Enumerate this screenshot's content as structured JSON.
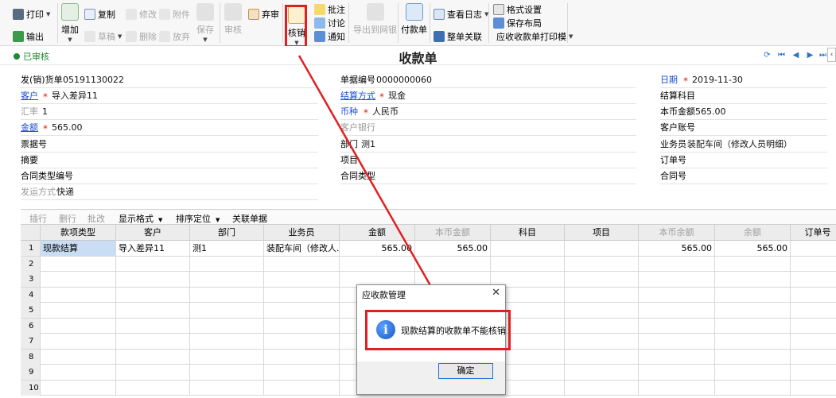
{
  "toolbar": {
    "print": "打印",
    "export": "输出",
    "add": "增加",
    "copy": "复制",
    "draft": "草稿",
    "modify": "修改",
    "delete": "删除",
    "attachment": "附件",
    "abandon": "放弃",
    "save": "保存",
    "audit": "审核",
    "unaudit": "弃审",
    "writeoff": "核销",
    "annotate": "批注",
    "discuss": "讨论",
    "notify": "通知",
    "export_netbank": "导出到网银",
    "payment_order": "付款单",
    "view_log": "查看日志",
    "full_relation": "整单关联",
    "format_settings": "格式设置",
    "save_layout": "保存布局",
    "print_template": "应收收款单打印模"
  },
  "header": {
    "status": "已审核",
    "title": "收款单"
  },
  "form": {
    "invoice_no_label": "发(销)货单",
    "invoice_no": "05191130022",
    "doc_no_label": "单据编号",
    "doc_no": "0000000060",
    "date_label": "日期",
    "date": "2019-11-30",
    "customer_label": "客户",
    "customer": "导入差异11",
    "settle_method_label": "结算方式",
    "settle_method": "现金",
    "settle_subject_label": "结算科目",
    "rate_label": "汇率",
    "rate": "1",
    "currency_label": "币种",
    "currency": "人民币",
    "local_amount_label": "本币金额",
    "local_amount": "565.00",
    "amount_label": "金额",
    "amount": "565.00",
    "customer_bank_label": "客户银行",
    "customer_account_label": "客户账号",
    "bill_no_label": "票据号",
    "department_label": "部门",
    "department": "测1",
    "salesman_label": "业务员",
    "salesman": "装配车间（修改人员明细）",
    "summary_label": "摘要",
    "project_label": "项目",
    "order_no_label": "订单号",
    "contract_type_no_label": "合同类型编号",
    "contract_type_label": "合同类型",
    "contract_no_label": "合同号",
    "ship_method_label": "发运方式",
    "ship_method": "快递"
  },
  "grid": {
    "toolbar": {
      "insert_row": "插行",
      "delete_row": "删行",
      "batch_edit": "批改",
      "display_format": "显示格式",
      "sort_locate": "排序定位",
      "related_doc": "关联单据"
    },
    "columns": [
      "款项类型",
      "客户",
      "部门",
      "业务员",
      "金额",
      "本币金额",
      "科目",
      "项目",
      "本币余额",
      "余额",
      "订单号"
    ],
    "rows": [
      {
        "n": "1",
        "cells": [
          "现款结算",
          "导入差异11",
          "测1",
          "装配车间（修改人...",
          "565.00",
          "565.00",
          "",
          "",
          "565.00",
          "565.00",
          ""
        ]
      },
      {
        "n": "2",
        "cells": [
          "",
          "",
          "",
          "",
          "",
          "",
          "",
          "",
          "",
          "",
          ""
        ]
      },
      {
        "n": "3",
        "cells": [
          "",
          "",
          "",
          "",
          "",
          "",
          "",
          "",
          "",
          "",
          ""
        ]
      },
      {
        "n": "4",
        "cells": [
          "",
          "",
          "",
          "",
          "",
          "",
          "",
          "",
          "",
          "",
          ""
        ]
      },
      {
        "n": "5",
        "cells": [
          "",
          "",
          "",
          "",
          "",
          "",
          "",
          "",
          "",
          "",
          ""
        ]
      },
      {
        "n": "6",
        "cells": [
          "",
          "",
          "",
          "",
          "",
          "",
          "",
          "",
          "",
          "",
          ""
        ]
      },
      {
        "n": "7",
        "cells": [
          "",
          "",
          "",
          "",
          "",
          "",
          "",
          "",
          "",
          "",
          ""
        ]
      },
      {
        "n": "8",
        "cells": [
          "",
          "",
          "",
          "",
          "",
          "",
          "",
          "",
          "",
          "",
          ""
        ]
      },
      {
        "n": "9",
        "cells": [
          "",
          "",
          "",
          "",
          "",
          "",
          "",
          "",
          "",
          "",
          ""
        ]
      },
      {
        "n": "10",
        "cells": [
          "",
          "",
          "",
          "",
          "",
          "",
          "",
          "",
          "",
          "",
          ""
        ]
      }
    ]
  },
  "dialog": {
    "title": "应收款管理",
    "message": "现款结算的收款单不能核销",
    "ok": "确定"
  },
  "colors": {
    "highlight": "#e02020",
    "status_green": "#1d8a34",
    "label_blue": "#1f4fd0",
    "selected_cell": "#c9def5"
  }
}
